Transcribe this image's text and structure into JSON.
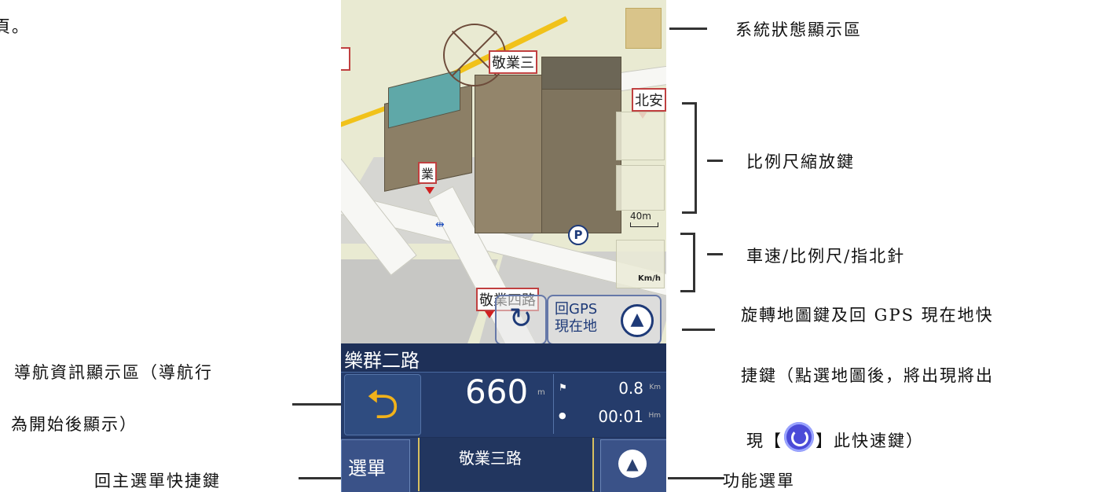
{
  "annotations": {
    "status_area": "系統狀態顯示區",
    "zoom_keys": "比例尺縮放鍵",
    "speed_scale_compass": "車速/比例尺/指北針",
    "rotate_gps_line1": "旋轉地圖鍵及回 GPS 現在地快",
    "rotate_gps_line2": "捷鍵（點選地圖後，將出現將出",
    "rotate_gps_line3_a": "現【",
    "rotate_gps_line3_b": "】此快速鍵）",
    "nav_info_line1": "導航資訊顯示區（導航行",
    "nav_info_line2": "為開始後顯示）",
    "main_menu_shortcut": "回主選單快捷鍵",
    "function_menu": "功能選單",
    "top_fragment": "頁。"
  },
  "map": {
    "label_top": "敬業三",
    "label_right": "北安",
    "label_left": "",
    "label_small": "業",
    "label_bottom": "敬業四路",
    "scale": "40m",
    "speed_unit": "Km/h",
    "gps_button": "回GPS\n現在地",
    "parking": "P"
  },
  "nav": {
    "street": "樂群二路",
    "turn_icon": "u-turn-left-icon",
    "distance": "660",
    "distance_unit": "m",
    "remaining_distance": "0.8",
    "remaining_distance_unit": "Km",
    "remaining_time": "00:01",
    "remaining_time_unit": "Hm"
  },
  "bottom_bar": {
    "menu_label": "選單",
    "current_road": "敬業三路",
    "function_icon": "up-triangle-icon"
  },
  "colors": {
    "nav_bg": "#1e3058",
    "turn_arrow": "#f2b21a",
    "label_border": "#c04040",
    "map_bg": "#e9ead2"
  }
}
